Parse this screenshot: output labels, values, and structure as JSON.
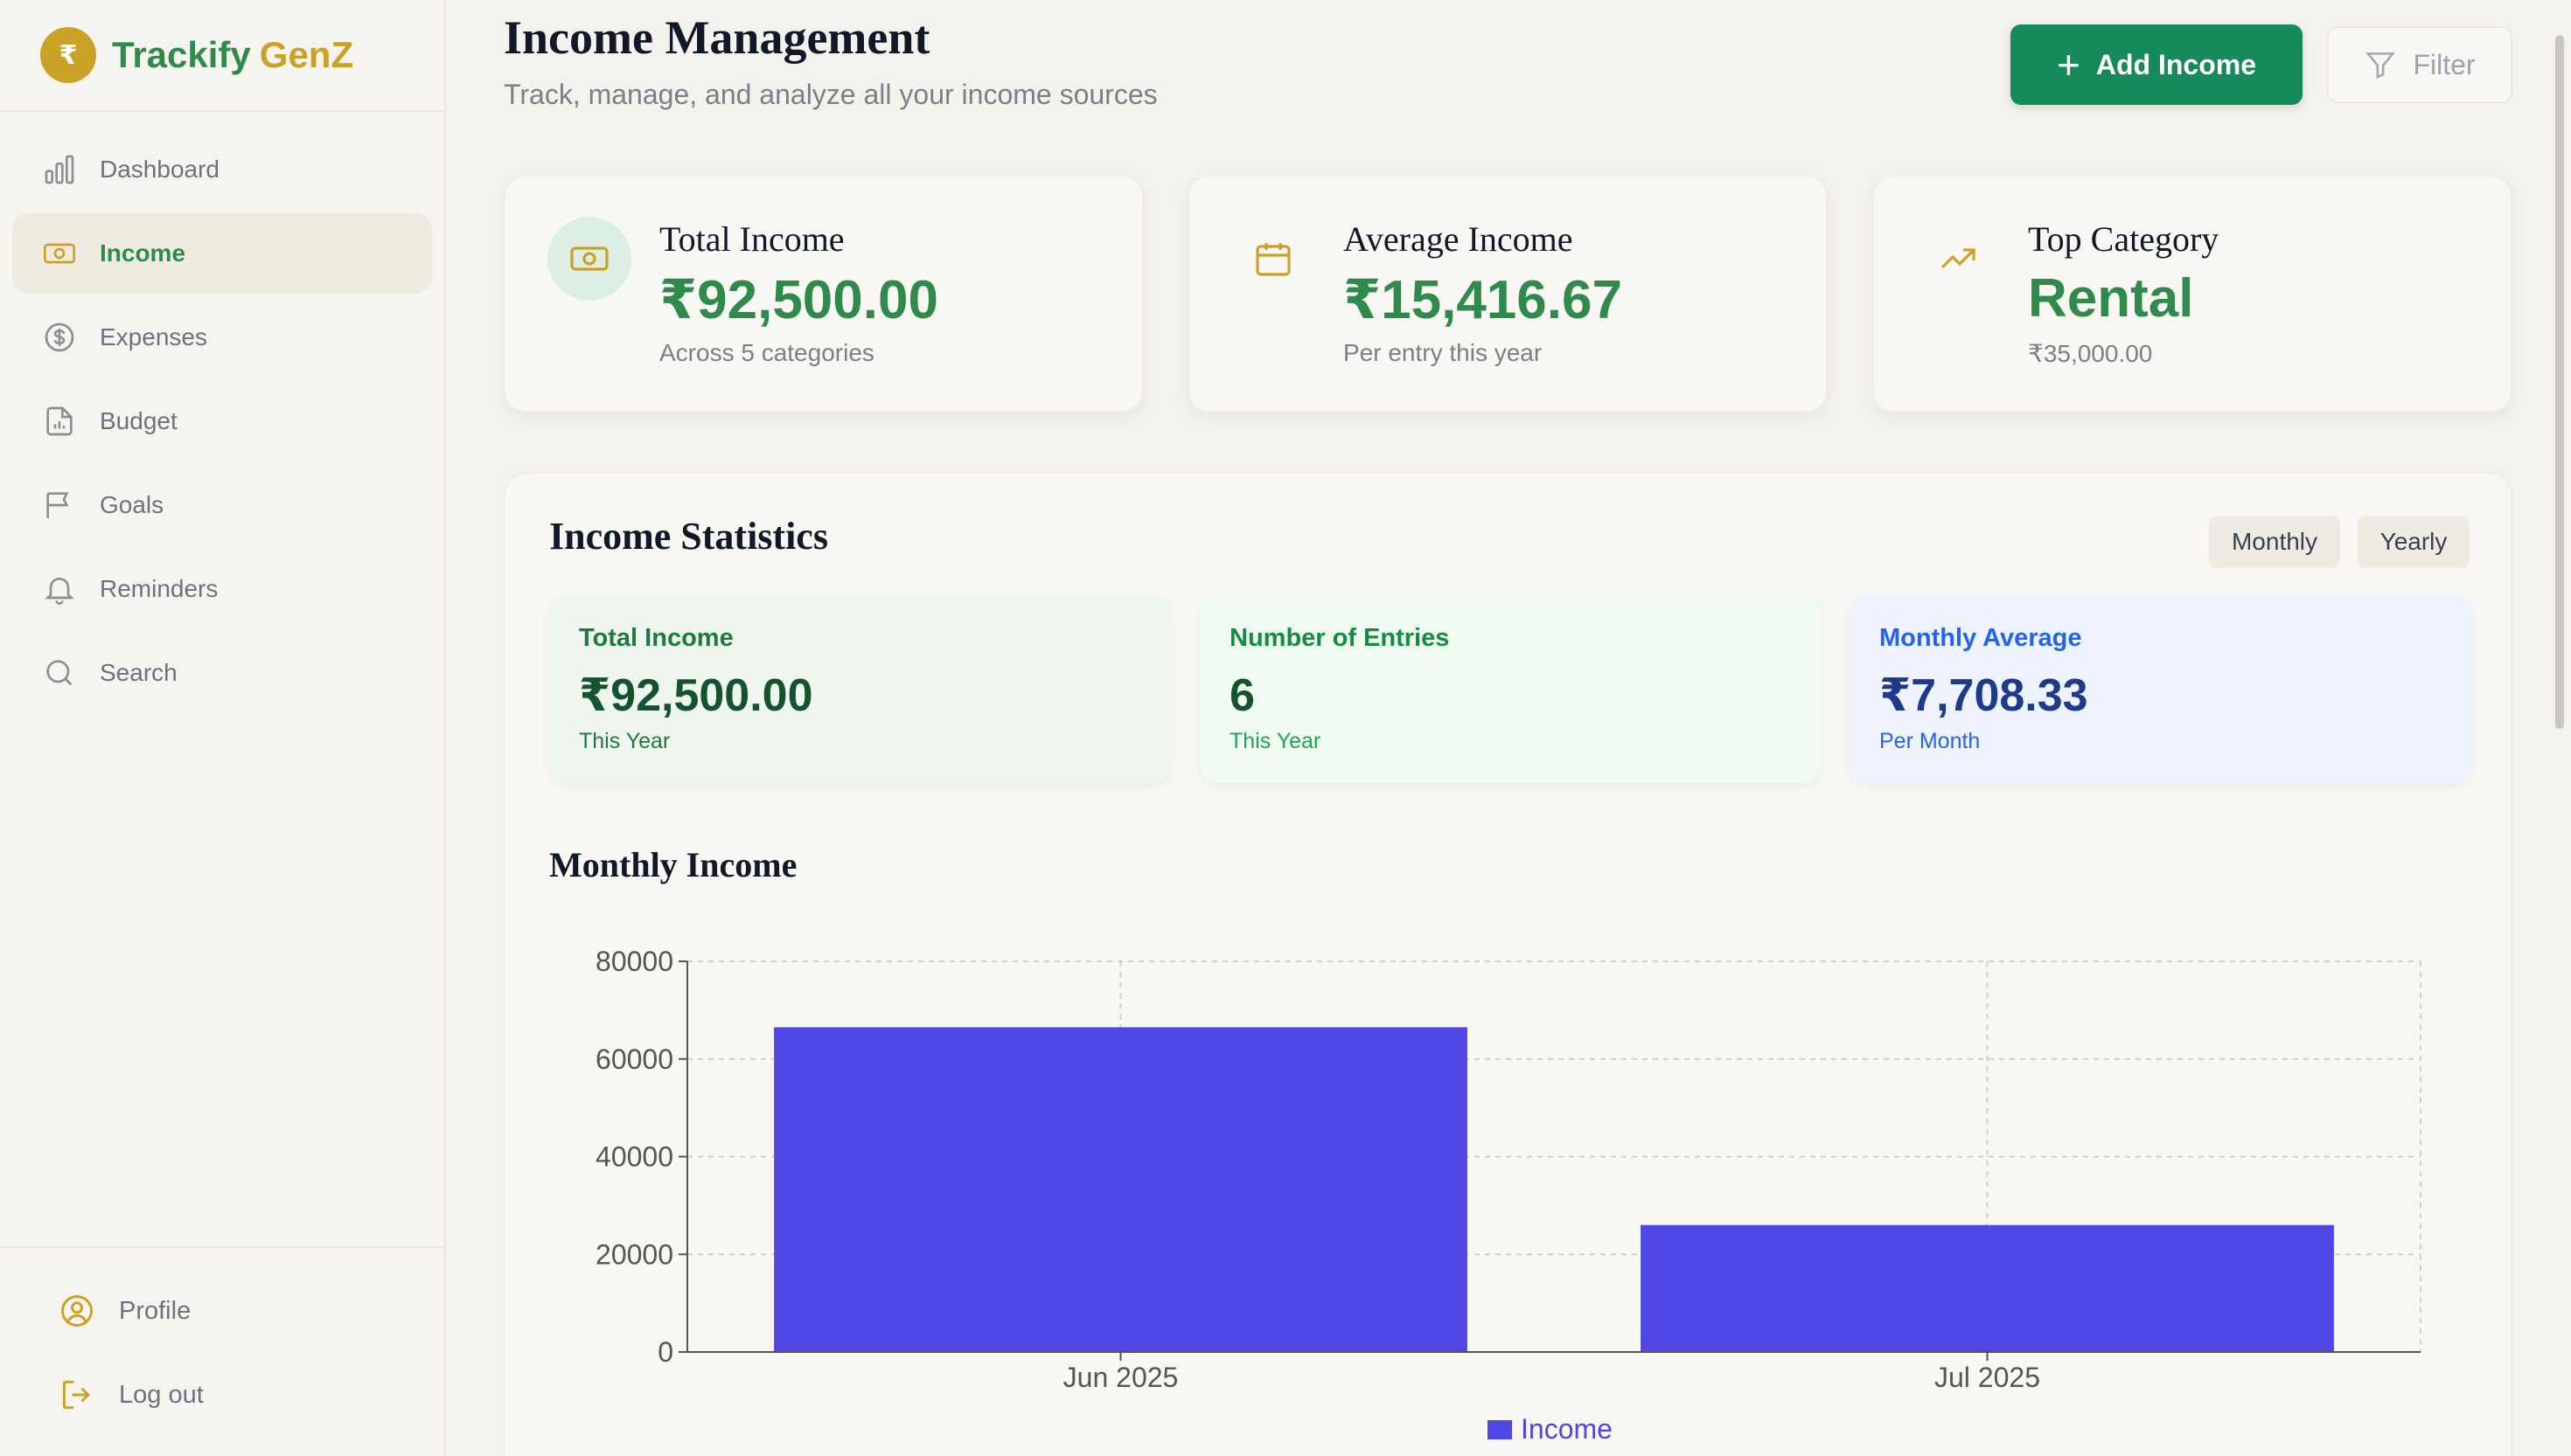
{
  "brand": {
    "logo_symbol": "₹",
    "name": "Trackify",
    "accent": "GenZ"
  },
  "nav": {
    "items": [
      {
        "label": "Dashboard",
        "icon": "bar-chart-icon"
      },
      {
        "label": "Income",
        "icon": "banknote-icon",
        "active": true
      },
      {
        "label": "Expenses",
        "icon": "dollar-circle-icon"
      },
      {
        "label": "Budget",
        "icon": "document-chart-icon"
      },
      {
        "label": "Goals",
        "icon": "flag-icon"
      },
      {
        "label": "Reminders",
        "icon": "bell-icon"
      },
      {
        "label": "Search",
        "icon": "search-icon"
      }
    ],
    "bottom": [
      {
        "label": "Profile",
        "icon": "user-circle-icon"
      },
      {
        "label": "Log out",
        "icon": "logout-icon"
      }
    ]
  },
  "header": {
    "title": "Income Management",
    "subtitle": "Track, manage, and analyze all your income sources",
    "add_label": "Add Income",
    "filter_label": "Filter"
  },
  "cards": [
    {
      "label": "Total Income",
      "value": "₹92,500.00",
      "sub": "Across 5 categories",
      "icon": "banknote-icon"
    },
    {
      "label": "Average Income",
      "value": "₹15,416.67",
      "sub": "Per entry this year",
      "icon": "calendar-icon"
    },
    {
      "label": "Top Category",
      "value": "Rental",
      "sub": "₹35,000.00",
      "icon": "trending-up-icon"
    }
  ],
  "stats": {
    "title": "Income Statistics",
    "toggles": [
      "Monthly",
      "Yearly"
    ],
    "mini": [
      {
        "label": "Total Income",
        "value": "₹92,500.00",
        "sub": "This Year"
      },
      {
        "label": "Number of Entries",
        "value": "6",
        "sub": "This Year"
      },
      {
        "label": "Monthly Average",
        "value": "₹7,708.33",
        "sub": "Per Month"
      }
    ]
  },
  "colors": {
    "primary_green": "#2f8a4c",
    "button_green": "#158a5a",
    "gold": "#c9a227",
    "bar": "#4f46e5"
  },
  "chart_data": {
    "type": "bar",
    "title": "Monthly Income",
    "categories": [
      "Jun 2025",
      "Jul 2025"
    ],
    "series": [
      {
        "name": "Income",
        "values": [
          66500,
          26000
        ]
      }
    ],
    "ylim": [
      0,
      80000
    ],
    "yticks": [
      0,
      20000,
      40000,
      60000,
      80000
    ],
    "grid": true,
    "legend": "bottom"
  }
}
